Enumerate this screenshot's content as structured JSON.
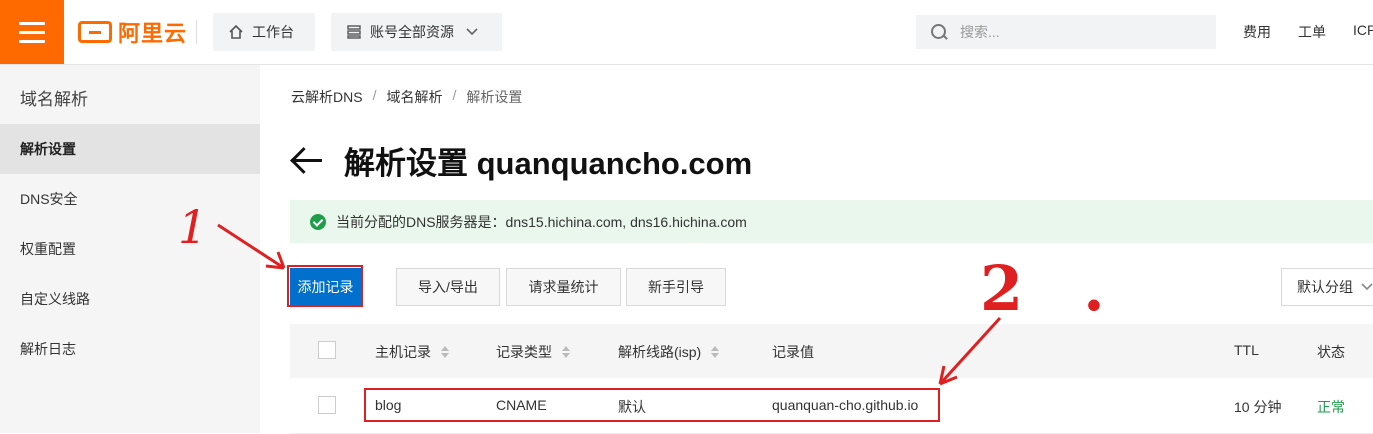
{
  "topbar": {
    "menu_icon": "hamburger-icon",
    "logo_text": "阿里云",
    "workbench_label": "工作台",
    "resources_label": "账号全部资源",
    "search_placeholder": "搜索...",
    "links": [
      "费用",
      "工单",
      "ICP"
    ],
    "accent_color": "#ff6a00"
  },
  "sidebar": {
    "title": "域名解析",
    "items": [
      {
        "label": "解析设置",
        "active": true
      },
      {
        "label": "DNS安全",
        "active": false
      },
      {
        "label": "权重配置",
        "active": false
      },
      {
        "label": "自定义线路",
        "active": false
      },
      {
        "label": "解析日志",
        "active": false
      }
    ]
  },
  "breadcrumb": [
    "云解析DNS",
    "域名解析",
    "解析设置"
  ],
  "breadcrumb_sep": "/",
  "page": {
    "title": "解析设置 quanquancho.com",
    "dns_notice": "当前分配的DNS服务器是：dns15.hichina.com, dns16.hichina.com"
  },
  "actions": {
    "add_record": "添加记录",
    "import_export": "导入/导出",
    "request_stats": "请求量统计",
    "guide": "新手引导",
    "group_select": "默认分组"
  },
  "table": {
    "columns": [
      "主机记录",
      "记录类型",
      "解析线路(isp)",
      "记录值",
      "TTL",
      "状态"
    ],
    "rows": [
      {
        "host": "blog",
        "type": "CNAME",
        "line": "默认",
        "value": "quanquan-cho.github.io",
        "ttl": "10 分钟",
        "status": "正常"
      }
    ]
  },
  "annotations": {
    "mark_1": "1",
    "mark_2": "2.",
    "color": "#e02020"
  }
}
